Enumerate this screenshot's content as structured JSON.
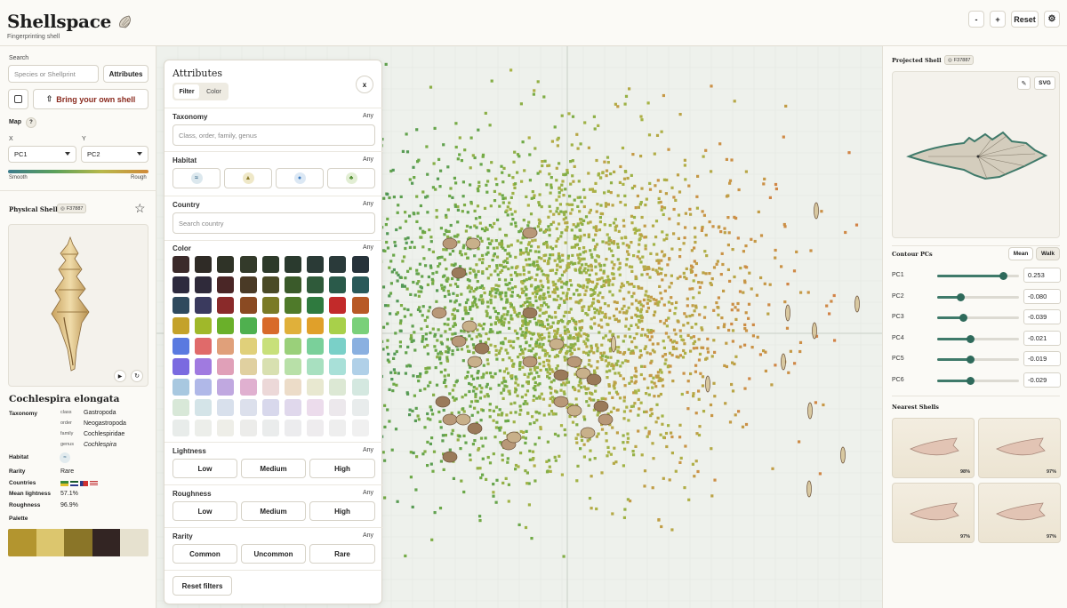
{
  "header": {
    "app_title": "Shellspace",
    "subtitle": "Fingerprinting shell",
    "zoom_out_label": "-",
    "zoom_in_label": "+",
    "reset_label": "Reset",
    "settings_icon": "gear-icon"
  },
  "left": {
    "search_label": "Search",
    "search_placeholder": "Species or Shellprint",
    "attributes_button": "Attributes",
    "upload_button": "Bring your own shell",
    "map_label": "Map",
    "help_label": "?",
    "x_label": "X",
    "y_label": "Y",
    "x_value": "PC1",
    "y_value": "PC2",
    "gradient_low": "Smooth",
    "gradient_high": "Rough",
    "physical_shell_label": "Physical Shell",
    "shell_code": "F37887",
    "species_name": "Cochlespira elongata",
    "taxonomy_label": "Taxonomy",
    "taxonomy": [
      {
        "rank": "class",
        "value": "Gastropoda"
      },
      {
        "rank": "order",
        "value": "Neogastropoda"
      },
      {
        "rank": "family",
        "value": "Cochlespiridae"
      },
      {
        "rank": "genus",
        "value": "Cochlespira"
      }
    ],
    "habitat_label": "Habitat",
    "rarity_label": "Rarity",
    "rarity_value": "Rare",
    "countries_label": "Countries",
    "mean_lightness_label": "Mean lightness",
    "mean_lightness_value": "57.1%",
    "roughness_label": "Roughness",
    "roughness_value": "96.9%",
    "palette_label": "Palette",
    "palette": [
      "#b3952f",
      "#dcc66e",
      "#8a7528",
      "#332523",
      "#e6e1cf"
    ]
  },
  "attributes": {
    "title": "Attributes",
    "tab_filter": "Filter",
    "tab_color": "Color",
    "close_label": "x",
    "any_label": "Any",
    "taxonomy_label": "Taxonomy",
    "taxonomy_placeholder": "Class, order, family, genus",
    "habitat_label": "Habitat",
    "country_label": "Country",
    "country_placeholder": "Search country",
    "color_label": "Color",
    "lightness_label": "Lightness",
    "lightness_options": [
      "Low",
      "Medium",
      "High"
    ],
    "roughness_label": "Roughness",
    "roughness_options": [
      "Low",
      "Medium",
      "High"
    ],
    "rarity_label": "Rarity",
    "rarity_options": [
      "Common",
      "Uncommon",
      "Rare"
    ],
    "reset_button": "Reset filters",
    "swatches": [
      [
        "#3b2a2a",
        "#2f2b26",
        "#2f3327",
        "#333a2a",
        "#2d3a2a",
        "#2a3a2e",
        "#2a3a36",
        "#2a3a3a",
        "#26323a"
      ],
      [
        "#2d2a3e",
        "#2f2a3a",
        "#4a2626",
        "#4a3a26",
        "#4a4a26",
        "#3a5a2a",
        "#2f5a3a",
        "#2a5a4a",
        "#2a5a5a"
      ],
      [
        "#2f4a5e",
        "#3a3a5e",
        "#8a2a2a",
        "#8a4a22",
        "#7a7a26",
        "#4f7a2a",
        "#2f7a3f",
        "#c22a2a",
        "#b85a26"
      ],
      [
        "#c4a22a",
        "#a0b82a",
        "#6ab02a",
        "#4fb04f",
        "#d86a2a",
        "#e0b03a",
        "#e0a02a",
        "#a8d04a",
        "#7ad07a"
      ],
      [
        "#5a7ae0",
        "#e06a6a",
        "#e0a07a",
        "#e0d07a",
        "#c8e07a",
        "#9ad07a",
        "#7ad09a",
        "#7ad0c8",
        "#8ab0e0"
      ],
      [
        "#7a6ae0",
        "#a07ae0",
        "#e0a0b8",
        "#e0d0a0",
        "#d8e0b0",
        "#b8e0a8",
        "#a8e0c0",
        "#a8e0d8",
        "#b0d0e8"
      ],
      [
        "#a8c8e0",
        "#b0b8e8",
        "#c0a8e0",
        "#e0b0d0",
        "#ecd8d8",
        "#ecdcc8",
        "#e8e8d0",
        "#dce8d4",
        "#d4e8e0"
      ],
      [
        "#d8e8d8",
        "#d4e4e8",
        "#d8e0ec",
        "#dce0ec",
        "#d8d8ec",
        "#e0d8ec",
        "#ecdcec",
        "#ece8ec",
        "#e8ecec"
      ],
      [
        "#e8ecea",
        "#eceeea",
        "#eeeee8",
        "#ececea",
        "#eaecec",
        "#ececee",
        "#eeecee",
        "#eeeeee",
        "#f0f0f0"
      ]
    ]
  },
  "right": {
    "projected_label": "Projected Shell",
    "shell_code": "F37887",
    "svg_button": "SVG",
    "contour_label": "Contour PCs",
    "mean_button": "Mean",
    "walk_button": "Walk",
    "pcs": [
      {
        "name": "PC1",
        "value": "0.253",
        "level": 0.8
      },
      {
        "name": "PC2",
        "value": "-0.080",
        "level": 0.28
      },
      {
        "name": "PC3",
        "value": "-0.039",
        "level": 0.31
      },
      {
        "name": "PC4",
        "value": "-0.021",
        "level": 0.4
      },
      {
        "name": "PC5",
        "value": "-0.019",
        "level": 0.4
      },
      {
        "name": "PC6",
        "value": "-0.029",
        "level": 0.4
      }
    ],
    "nearest_label": "Nearest Shells",
    "nearest": [
      {
        "pct": "98%"
      },
      {
        "pct": "97%"
      },
      {
        "pct": "97%"
      },
      {
        "pct": "97%"
      }
    ]
  }
}
